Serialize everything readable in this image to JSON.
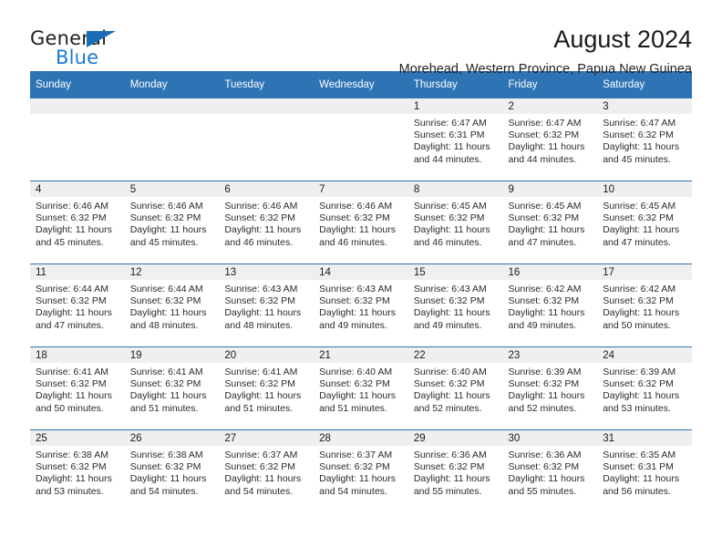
{
  "brand": {
    "name_top": "General",
    "name_bottom": "Blue",
    "accent_color": "#1b7ad1",
    "triangle_color": "#1b6eb5"
  },
  "header": {
    "title": "August 2024",
    "subtitle": "Morehead, Western Province, Papua New Guinea"
  },
  "calendar": {
    "header_bg": "#2e74b5",
    "daynum_bg": "#efefef",
    "weekday_headers": [
      "Sunday",
      "Monday",
      "Tuesday",
      "Wednesday",
      "Thursday",
      "Friday",
      "Saturday"
    ],
    "weeks": [
      [
        {
          "day": "",
          "lines": []
        },
        {
          "day": "",
          "lines": []
        },
        {
          "day": "",
          "lines": []
        },
        {
          "day": "",
          "lines": []
        },
        {
          "day": "1",
          "lines": [
            "Sunrise: 6:47 AM",
            "Sunset: 6:31 PM",
            "Daylight: 11 hours",
            "and 44 minutes."
          ]
        },
        {
          "day": "2",
          "lines": [
            "Sunrise: 6:47 AM",
            "Sunset: 6:32 PM",
            "Daylight: 11 hours",
            "and 44 minutes."
          ]
        },
        {
          "day": "3",
          "lines": [
            "Sunrise: 6:47 AM",
            "Sunset: 6:32 PM",
            "Daylight: 11 hours",
            "and 45 minutes."
          ]
        }
      ],
      [
        {
          "day": "4",
          "lines": [
            "Sunrise: 6:46 AM",
            "Sunset: 6:32 PM",
            "Daylight: 11 hours",
            "and 45 minutes."
          ]
        },
        {
          "day": "5",
          "lines": [
            "Sunrise: 6:46 AM",
            "Sunset: 6:32 PM",
            "Daylight: 11 hours",
            "and 45 minutes."
          ]
        },
        {
          "day": "6",
          "lines": [
            "Sunrise: 6:46 AM",
            "Sunset: 6:32 PM",
            "Daylight: 11 hours",
            "and 46 minutes."
          ]
        },
        {
          "day": "7",
          "lines": [
            "Sunrise: 6:46 AM",
            "Sunset: 6:32 PM",
            "Daylight: 11 hours",
            "and 46 minutes."
          ]
        },
        {
          "day": "8",
          "lines": [
            "Sunrise: 6:45 AM",
            "Sunset: 6:32 PM",
            "Daylight: 11 hours",
            "and 46 minutes."
          ]
        },
        {
          "day": "9",
          "lines": [
            "Sunrise: 6:45 AM",
            "Sunset: 6:32 PM",
            "Daylight: 11 hours",
            "and 47 minutes."
          ]
        },
        {
          "day": "10",
          "lines": [
            "Sunrise: 6:45 AM",
            "Sunset: 6:32 PM",
            "Daylight: 11 hours",
            "and 47 minutes."
          ]
        }
      ],
      [
        {
          "day": "11",
          "lines": [
            "Sunrise: 6:44 AM",
            "Sunset: 6:32 PM",
            "Daylight: 11 hours",
            "and 47 minutes."
          ]
        },
        {
          "day": "12",
          "lines": [
            "Sunrise: 6:44 AM",
            "Sunset: 6:32 PM",
            "Daylight: 11 hours",
            "and 48 minutes."
          ]
        },
        {
          "day": "13",
          "lines": [
            "Sunrise: 6:43 AM",
            "Sunset: 6:32 PM",
            "Daylight: 11 hours",
            "and 48 minutes."
          ]
        },
        {
          "day": "14",
          "lines": [
            "Sunrise: 6:43 AM",
            "Sunset: 6:32 PM",
            "Daylight: 11 hours",
            "and 49 minutes."
          ]
        },
        {
          "day": "15",
          "lines": [
            "Sunrise: 6:43 AM",
            "Sunset: 6:32 PM",
            "Daylight: 11 hours",
            "and 49 minutes."
          ]
        },
        {
          "day": "16",
          "lines": [
            "Sunrise: 6:42 AM",
            "Sunset: 6:32 PM",
            "Daylight: 11 hours",
            "and 49 minutes."
          ]
        },
        {
          "day": "17",
          "lines": [
            "Sunrise: 6:42 AM",
            "Sunset: 6:32 PM",
            "Daylight: 11 hours",
            "and 50 minutes."
          ]
        }
      ],
      [
        {
          "day": "18",
          "lines": [
            "Sunrise: 6:41 AM",
            "Sunset: 6:32 PM",
            "Daylight: 11 hours",
            "and 50 minutes."
          ]
        },
        {
          "day": "19",
          "lines": [
            "Sunrise: 6:41 AM",
            "Sunset: 6:32 PM",
            "Daylight: 11 hours",
            "and 51 minutes."
          ]
        },
        {
          "day": "20",
          "lines": [
            "Sunrise: 6:41 AM",
            "Sunset: 6:32 PM",
            "Daylight: 11 hours",
            "and 51 minutes."
          ]
        },
        {
          "day": "21",
          "lines": [
            "Sunrise: 6:40 AM",
            "Sunset: 6:32 PM",
            "Daylight: 11 hours",
            "and 51 minutes."
          ]
        },
        {
          "day": "22",
          "lines": [
            "Sunrise: 6:40 AM",
            "Sunset: 6:32 PM",
            "Daylight: 11 hours",
            "and 52 minutes."
          ]
        },
        {
          "day": "23",
          "lines": [
            "Sunrise: 6:39 AM",
            "Sunset: 6:32 PM",
            "Daylight: 11 hours",
            "and 52 minutes."
          ]
        },
        {
          "day": "24",
          "lines": [
            "Sunrise: 6:39 AM",
            "Sunset: 6:32 PM",
            "Daylight: 11 hours",
            "and 53 minutes."
          ]
        }
      ],
      [
        {
          "day": "25",
          "lines": [
            "Sunrise: 6:38 AM",
            "Sunset: 6:32 PM",
            "Daylight: 11 hours",
            "and 53 minutes."
          ]
        },
        {
          "day": "26",
          "lines": [
            "Sunrise: 6:38 AM",
            "Sunset: 6:32 PM",
            "Daylight: 11 hours",
            "and 54 minutes."
          ]
        },
        {
          "day": "27",
          "lines": [
            "Sunrise: 6:37 AM",
            "Sunset: 6:32 PM",
            "Daylight: 11 hours",
            "and 54 minutes."
          ]
        },
        {
          "day": "28",
          "lines": [
            "Sunrise: 6:37 AM",
            "Sunset: 6:32 PM",
            "Daylight: 11 hours",
            "and 54 minutes."
          ]
        },
        {
          "day": "29",
          "lines": [
            "Sunrise: 6:36 AM",
            "Sunset: 6:32 PM",
            "Daylight: 11 hours",
            "and 55 minutes."
          ]
        },
        {
          "day": "30",
          "lines": [
            "Sunrise: 6:36 AM",
            "Sunset: 6:32 PM",
            "Daylight: 11 hours",
            "and 55 minutes."
          ]
        },
        {
          "day": "31",
          "lines": [
            "Sunrise: 6:35 AM",
            "Sunset: 6:31 PM",
            "Daylight: 11 hours",
            "and 56 minutes."
          ]
        }
      ]
    ]
  }
}
